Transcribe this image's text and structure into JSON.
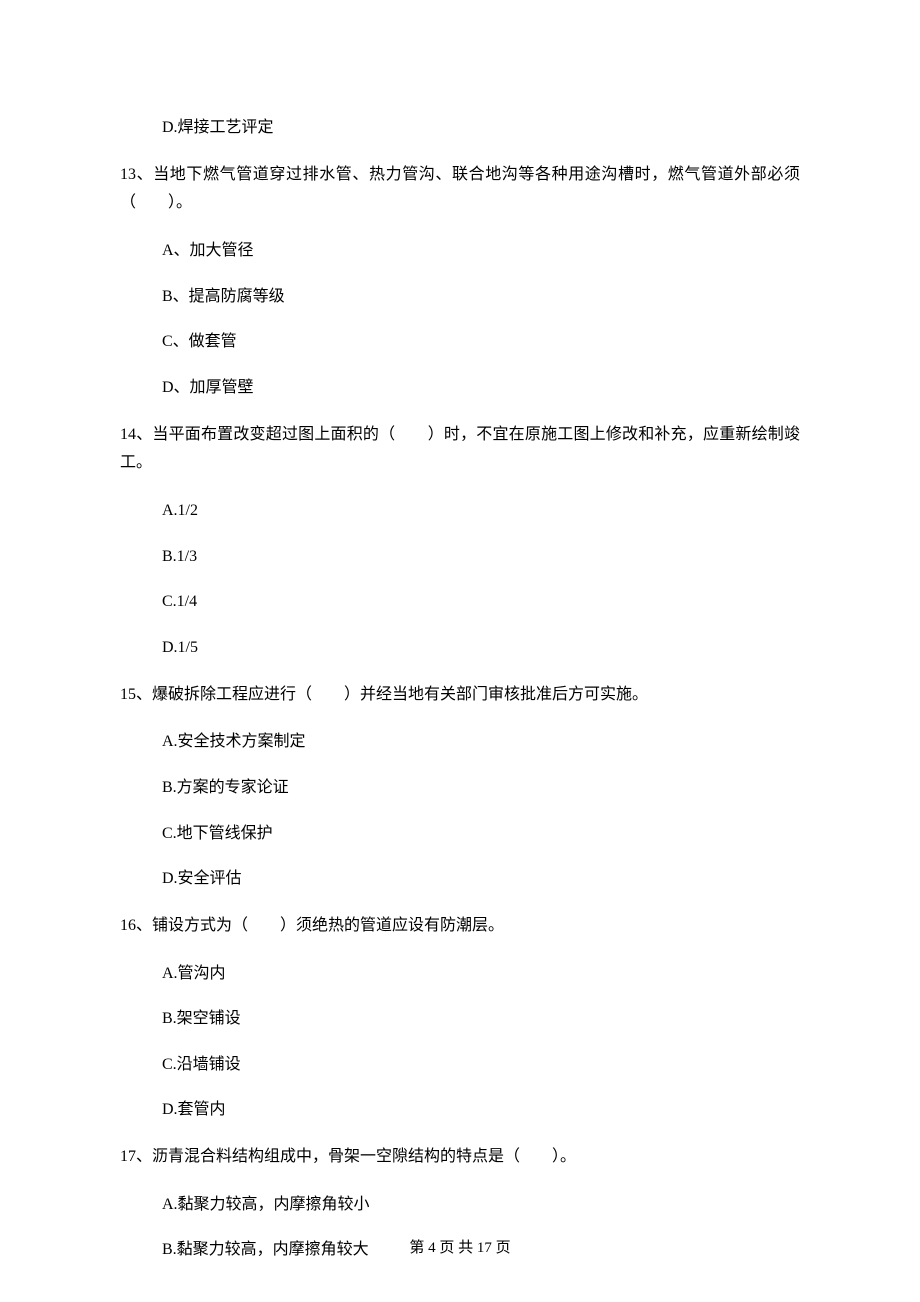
{
  "q12": {
    "optD": "D.焊接工艺评定"
  },
  "q13": {
    "stem": "13、当地下燃气管道穿过排水管、热力管沟、联合地沟等各种用途沟槽时，燃气管道外部必须（　　）。",
    "optA": "A、加大管径",
    "optB": "B、提高防腐等级",
    "optC": "C、做套管",
    "optD": "D、加厚管壁"
  },
  "q14": {
    "stem": "14、当平面布置改变超过图上面积的（　　）时，不宜在原施工图上修改和补充，应重新绘制竣工。",
    "optA": "A.1/2",
    "optB": "B.1/3",
    "optC": "C.1/4",
    "optD": "D.1/5"
  },
  "q15": {
    "stem": "15、爆破拆除工程应进行（　　）并经当地有关部门审核批准后方可实施。",
    "optA": "A.安全技术方案制定",
    "optB": "B.方案的专家论证",
    "optC": "C.地下管线保护",
    "optD": "D.安全评估"
  },
  "q16": {
    "stem": "16、铺设方式为（　　）须绝热的管道应设有防潮层。",
    "optA": "A.管沟内",
    "optB": "B.架空铺设",
    "optC": "C.沿墙铺设",
    "optD": "D.套管内"
  },
  "q17": {
    "stem": "17、沥青混合料结构组成中，骨架一空隙结构的特点是（　　）。",
    "optA": "A.黏聚力较高，内摩擦角较小",
    "optB": "B.黏聚力较高，内摩擦角较大"
  },
  "footer": "第 4 页 共 17 页"
}
